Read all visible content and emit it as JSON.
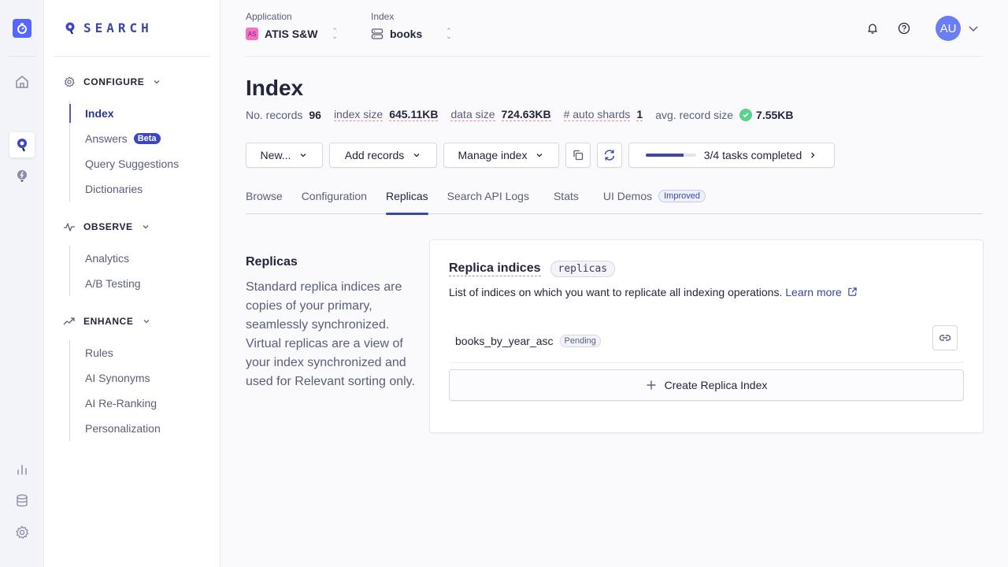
{
  "brand": {
    "name": "SEARCH",
    "accent": "#5468ff"
  },
  "rail": {
    "items": [
      "logo-icon",
      "home-icon",
      "search-product-icon",
      "recommend-bulb-icon",
      "analytics-bars-icon",
      "database-icon",
      "settings-gear-icon"
    ],
    "active": "search-product-icon"
  },
  "sidebar": {
    "sections": [
      {
        "label": "CONFIGURE",
        "icon": "gear-icon",
        "items": [
          {
            "label": "Index",
            "active": true
          },
          {
            "label": "Answers",
            "badge": "Beta"
          },
          {
            "label": "Query Suggestions"
          },
          {
            "label": "Dictionaries"
          }
        ]
      },
      {
        "label": "OBSERVE",
        "icon": "pulse-icon",
        "items": [
          {
            "label": "Analytics"
          },
          {
            "label": "A/B Testing"
          }
        ]
      },
      {
        "label": "ENHANCE",
        "icon": "trend-up-icon",
        "items": [
          {
            "label": "Rules"
          },
          {
            "label": "AI Synonyms"
          },
          {
            "label": "AI Re-Ranking"
          },
          {
            "label": "Personalization"
          }
        ]
      }
    ]
  },
  "header": {
    "application": {
      "label": "Application",
      "badge": "AS",
      "value": "ATIS S&W"
    },
    "index": {
      "label": "Index",
      "value": "books"
    },
    "avatar": "AU"
  },
  "page": {
    "title": "Index",
    "stats": {
      "records_label": "No. records",
      "records_value": "96",
      "index_size_label": "index size",
      "index_size_value": "645.11KB",
      "data_size_label": "data size",
      "data_size_value": "724.63KB",
      "shards_label": "# auto shards",
      "shards_value": "1",
      "avg_label": "avg. record size",
      "avg_value": "7.55KB"
    }
  },
  "toolbar": {
    "new_label": "New...",
    "add_records_label": "Add records",
    "manage_index_label": "Manage index",
    "tasks_label": "3/4 tasks completed",
    "tasks_progress": 0.75
  },
  "tabs": [
    {
      "label": "Browse"
    },
    {
      "label": "Configuration"
    },
    {
      "label": "Replicas",
      "active": true
    },
    {
      "label": "Search API Logs"
    },
    {
      "label": "Stats"
    },
    {
      "label": "UI Demos",
      "badge": "Improved"
    }
  ],
  "replicas": {
    "side_title": "Replicas",
    "side_body": "Standard replica indices are copies of your primary, seamlessly synchronized. Virtual replicas are a view of your index synchronized and used for Relevant sorting only.",
    "card_title": "Replica indices",
    "card_chip": "replicas",
    "card_sub": "List of indices on which you want to replicate all indexing operations.",
    "learn_more": "Learn more",
    "items": [
      {
        "name": "books_by_year_asc",
        "status": "Pending"
      }
    ],
    "create_label": "Create Replica Index"
  }
}
